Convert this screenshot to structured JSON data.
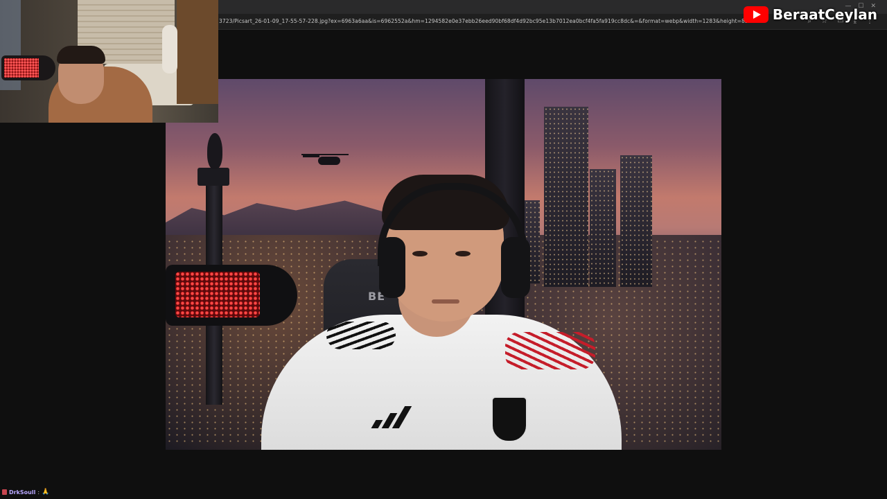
{
  "browser": {
    "url": "3723/Picsart_26-01-09_17-55-57-228.jpg?ex=6963a6aa&is=6962552a&hm=1294582e0e37ebb26eed90bf68df4d92bc95e13b7012ea0bcf4fa5fa919cc8dc&=&format=webp&width=1283&height=855"
  },
  "image": {
    "chair_logo": "BE"
  },
  "watermark": {
    "channel": "BeraatCeylan",
    "icon": "youtube-icon"
  },
  "chat": {
    "username": "DrkSoull",
    "separator": ":",
    "emote": "🙏"
  },
  "colors": {
    "background": "#0f0f0f",
    "youtube_red": "#ff0000",
    "chat_username": "#b9a8ff"
  }
}
